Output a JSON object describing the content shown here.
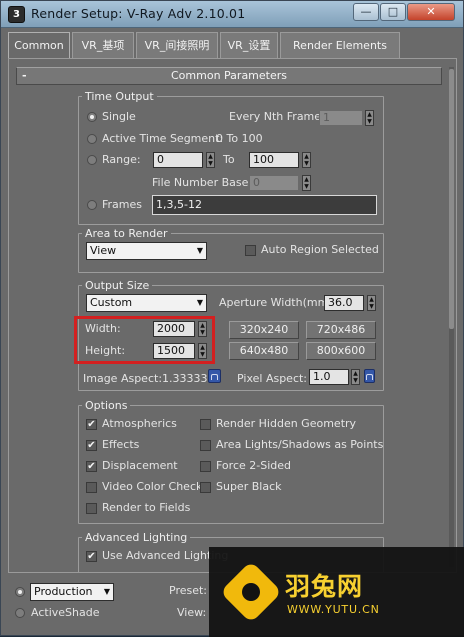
{
  "window": {
    "title": "Render Setup: V-Ray Adv 2.10.01",
    "app_icon": "3",
    "controls": [
      "—",
      "□",
      "✕"
    ]
  },
  "tabs": [
    {
      "label": "Common"
    },
    {
      "label": "VR_基项"
    },
    {
      "label": "VR_间接照明"
    },
    {
      "label": "VR_设置"
    },
    {
      "label": "Render Elements"
    }
  ],
  "rollout": {
    "collapse": "-",
    "title": "Common Parameters"
  },
  "time_output": {
    "legend": "Time Output",
    "single": "Single",
    "every_nth_label": "Every Nth Frame:",
    "every_nth_value": "1",
    "active_segment": "Active Time Segment:",
    "active_range": "0 To 100",
    "range": "Range:",
    "range_from": "0",
    "range_to_label": "To",
    "range_to": "100",
    "file_number_base_label": "File Number Base:",
    "file_number_base": "0",
    "frames": "Frames",
    "frames_value": "1,3,5-12"
  },
  "area_to_render": {
    "legend": "Area to Render",
    "selected": "View",
    "auto_region": "Auto Region Selected"
  },
  "output_size": {
    "legend": "Output Size",
    "preset": "Custom",
    "aperture_label": "Aperture Width(mm):",
    "aperture_value": "36.0",
    "width_label": "Width:",
    "width_value": "2000",
    "height_label": "Height:",
    "height_value": "1500",
    "presets": [
      "320x240",
      "720x486",
      "640x480",
      "800x600"
    ],
    "image_aspect": "Image Aspect:1.33333",
    "pixel_aspect_label": "Pixel Aspect:",
    "pixel_aspect_value": "1.0"
  },
  "options": {
    "legend": "Options",
    "left": [
      {
        "label": "Atmospherics",
        "checked": true
      },
      {
        "label": "Effects",
        "checked": true
      },
      {
        "label": "Displacement",
        "checked": true
      },
      {
        "label": "Video Color Check",
        "checked": false
      },
      {
        "label": "Render to Fields",
        "checked": false
      }
    ],
    "right": [
      {
        "label": "Render Hidden Geometry",
        "checked": false
      },
      {
        "label": "Area Lights/Shadows as Points",
        "checked": false
      },
      {
        "label": "Force 2-Sided",
        "checked": false
      },
      {
        "label": "Super Black",
        "checked": false
      }
    ]
  },
  "advanced_lighting": {
    "legend": "Advanced Lighting",
    "use": "Use Advanced Lighting"
  },
  "bottom": {
    "mode": "Production",
    "activeshade": "ActiveShade",
    "preset_label": "Preset:",
    "view_label": "View:"
  },
  "watermark": {
    "name": "羽兔网",
    "url": "WWW.YUTU.CN"
  },
  "colors": {
    "accent_red": "#d32020",
    "logo_yellow": "#f1b90c"
  },
  "icons": {
    "check": "✔",
    "spin_up": "▲",
    "spin_down": "▼",
    "dropdown": "▼"
  }
}
